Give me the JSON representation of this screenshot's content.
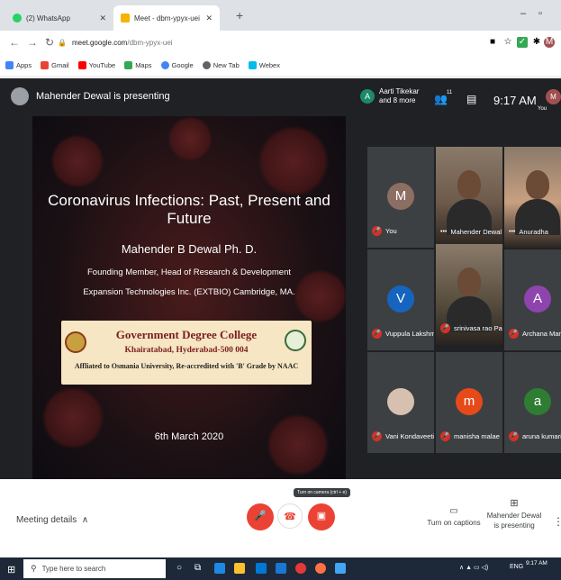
{
  "browser": {
    "tabs": [
      {
        "label": "(2) WhatsApp",
        "color": "#25d366"
      },
      {
        "label": "Meet - dbm-ypyx-uei",
        "color": "#f4b400"
      }
    ],
    "new_tab_glyph": "+",
    "minimize_glyph": "–",
    "restore_glyph": "▫",
    "url_host": "meet.google.com",
    "url_path": "/dbm-ypyx-uei",
    "bookmarks": [
      {
        "label": "Apps",
        "color": "#4285f4"
      },
      {
        "label": "Gmail",
        "color": "#ea4335"
      },
      {
        "label": "YouTube",
        "color": "#ff0000"
      },
      {
        "label": "Maps",
        "color": "#34a853"
      },
      {
        "label": "Google",
        "color": "#4285f4"
      },
      {
        "label": "New Tab",
        "color": "#5f6368"
      },
      {
        "label": "Webex",
        "color": "#00bceb"
      }
    ]
  },
  "meet": {
    "presenter_text": "Mahender Dewal is presenting",
    "participants_avatar_letter": "A",
    "participants_line1": "Aarti Tikekar",
    "participants_line2": "and 8 more",
    "people_count": "11",
    "time": "9:17 AM",
    "you_label": "You",
    "you_avatar_letter": "M"
  },
  "slide": {
    "title": "Coronavirus Infections: Past, Present and Future",
    "name": "Mahender B Dewal Ph. D.",
    "role": "Founding Member, Head of Research & Development",
    "company": "Expansion Technologies Inc. (EXTBIO) Cambridge, MA.",
    "college_name": "Government Degree College",
    "college_addr": "Khairatabad, Hyderabad-500 004",
    "college_aff": "Affliated to Osmania University, Re-accredited with 'B' Grade by NAAC",
    "date": "6th March 2020"
  },
  "tiles": [
    {
      "name": "You",
      "letter": "M",
      "color": "#8d6e63",
      "muted": true,
      "video": false
    },
    {
      "name": "Mahender Dewal",
      "letter": "",
      "color": "#6d5a4a",
      "muted": false,
      "video": true
    },
    {
      "name": "Anuradha",
      "letter": "",
      "color": "#c9a080",
      "muted": false,
      "video": true
    },
    {
      "name": "Vuppula Lakshmi",
      "letter": "V",
      "color": "#1565c0",
      "muted": true,
      "video": false
    },
    {
      "name": "srinivasa rao Pa...",
      "letter": "",
      "color": "#5a5040",
      "muted": true,
      "video": true
    },
    {
      "name": "Archana Mary",
      "letter": "A",
      "color": "#8e44ad",
      "muted": true,
      "video": false
    },
    {
      "name": "Vani Kondaveeti",
      "letter": "",
      "color": "#d8c0b0",
      "muted": true,
      "video": false
    },
    {
      "name": "manisha malae",
      "letter": "m",
      "color": "#e64a19",
      "muted": true,
      "video": false
    },
    {
      "name": "aruna kumari",
      "letter": "a",
      "color": "#2e7d32",
      "muted": true,
      "video": false
    }
  ],
  "controls": {
    "meeting_details": "Meeting details",
    "tooltip": "Turn on camera (ctrl + e)",
    "captions": "Turn on captions",
    "present_line1": "Mahender Dewal",
    "present_line2": "is presenting"
  },
  "taskbar": {
    "search_placeholder": "Type here to search",
    "lang": "ENG",
    "clock": "9:17 AM"
  }
}
